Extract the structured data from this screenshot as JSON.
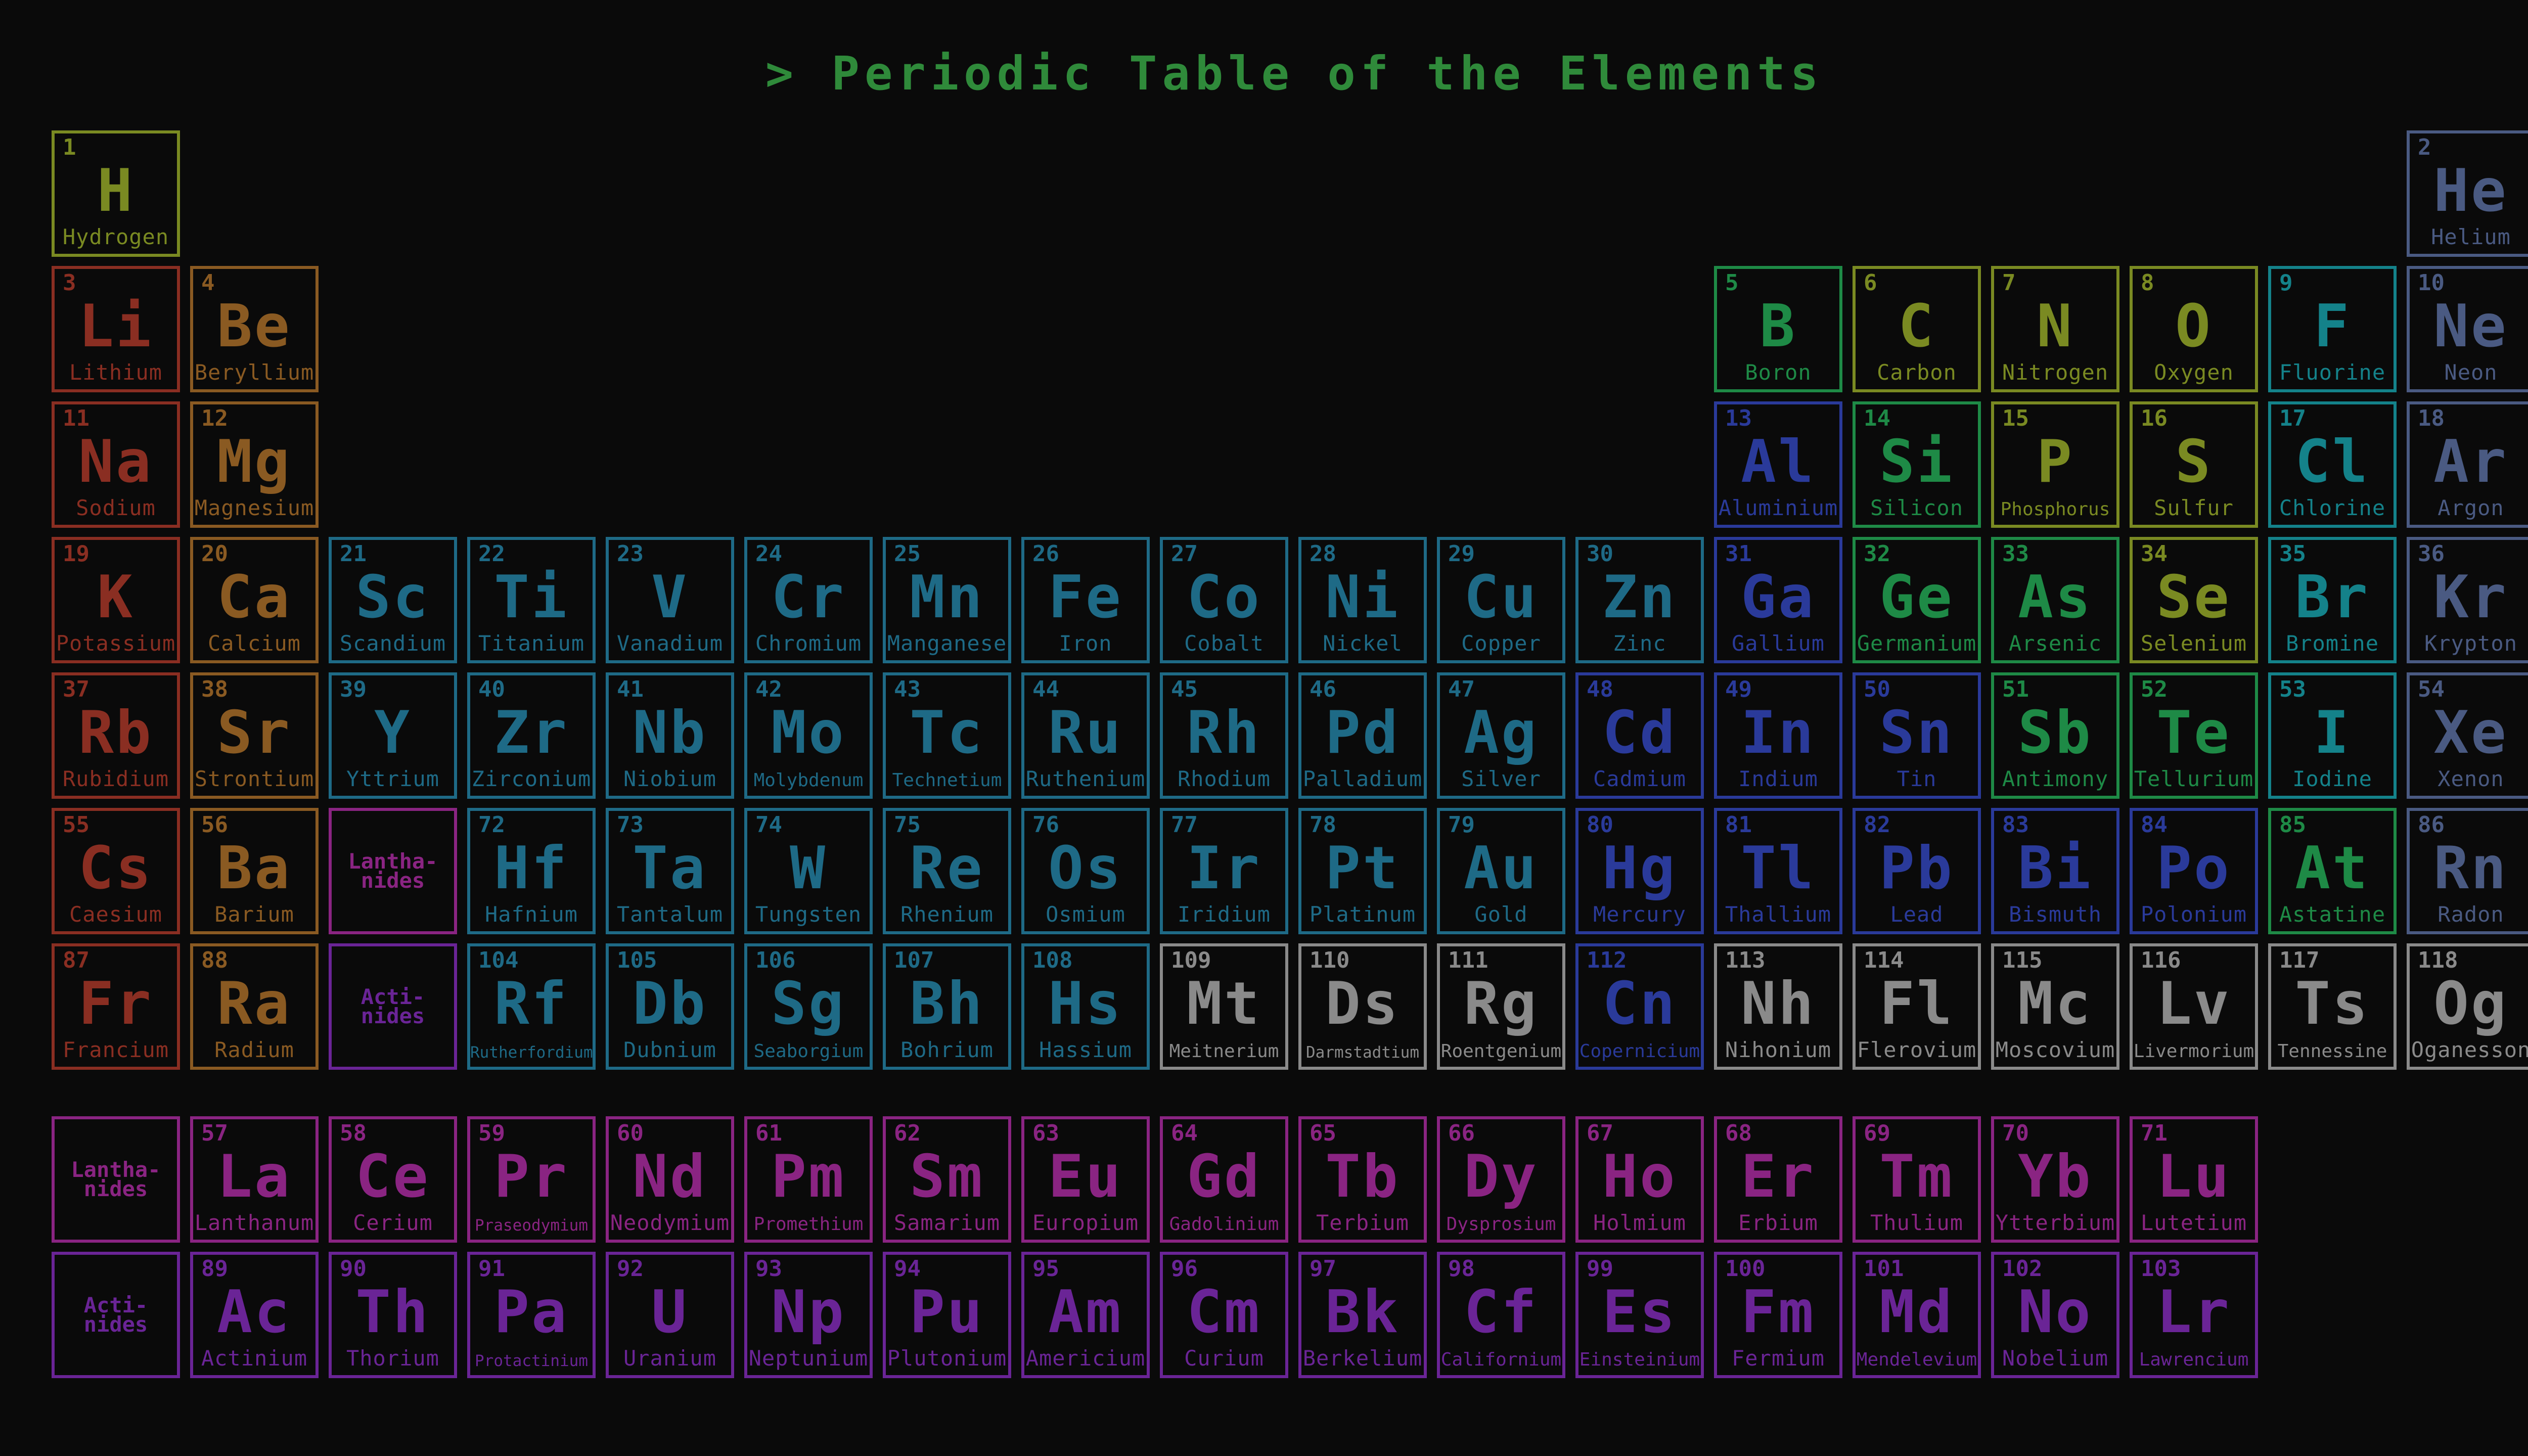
{
  "title": "> Periodic Table of the Elements",
  "colors": {
    "hydrogen": "#7a8a22",
    "alkali": "#8a2e22",
    "alkaline": "#8a5a22",
    "transition": "#1e6a86",
    "post_transition": "#2a3a9a",
    "metalloid": "#1e8a46",
    "nonmetal": "#7a8a22",
    "halogen": "#14828a",
    "noble": "#4a5a82",
    "lanthanide": "#8a2482",
    "actinide": "#6a2496",
    "unknown": "#8a8a8a"
  },
  "placeholders": {
    "lanthanides": "Lantha-\nnides",
    "actinides": "Acti-\nnides"
  },
  "elements": [
    {
      "n": 1,
      "s": "H",
      "name": "Hydrogen",
      "cat": "hydrogen",
      "row": 1,
      "col": 1
    },
    {
      "n": 2,
      "s": "He",
      "name": "Helium",
      "cat": "noble",
      "row": 1,
      "col": 18
    },
    {
      "n": 3,
      "s": "Li",
      "name": "Lithium",
      "cat": "alkali",
      "row": 2,
      "col": 1
    },
    {
      "n": 4,
      "s": "Be",
      "name": "Beryllium",
      "cat": "alkaline",
      "row": 2,
      "col": 2
    },
    {
      "n": 5,
      "s": "B",
      "name": "Boron",
      "cat": "metalloid",
      "row": 2,
      "col": 13
    },
    {
      "n": 6,
      "s": "C",
      "name": "Carbon",
      "cat": "nonmetal",
      "row": 2,
      "col": 14
    },
    {
      "n": 7,
      "s": "N",
      "name": "Nitrogen",
      "cat": "nonmetal",
      "row": 2,
      "col": 15
    },
    {
      "n": 8,
      "s": "O",
      "name": "Oxygen",
      "cat": "nonmetal",
      "row": 2,
      "col": 16
    },
    {
      "n": 9,
      "s": "F",
      "name": "Fluorine",
      "cat": "halogen",
      "row": 2,
      "col": 17
    },
    {
      "n": 10,
      "s": "Ne",
      "name": "Neon",
      "cat": "noble",
      "row": 2,
      "col": 18
    },
    {
      "n": 11,
      "s": "Na",
      "name": "Sodium",
      "cat": "alkali",
      "row": 3,
      "col": 1
    },
    {
      "n": 12,
      "s": "Mg",
      "name": "Magnesium",
      "cat": "alkaline",
      "row": 3,
      "col": 2
    },
    {
      "n": 13,
      "s": "Al",
      "name": "Aluminium",
      "cat": "post_transition",
      "row": 3,
      "col": 13
    },
    {
      "n": 14,
      "s": "Si",
      "name": "Silicon",
      "cat": "metalloid",
      "row": 3,
      "col": 14
    },
    {
      "n": 15,
      "s": "P",
      "name": "Phosphorus",
      "cat": "nonmetal",
      "row": 3,
      "col": 15
    },
    {
      "n": 16,
      "s": "S",
      "name": "Sulfur",
      "cat": "nonmetal",
      "row": 3,
      "col": 16
    },
    {
      "n": 17,
      "s": "Cl",
      "name": "Chlorine",
      "cat": "halogen",
      "row": 3,
      "col": 17
    },
    {
      "n": 18,
      "s": "Ar",
      "name": "Argon",
      "cat": "noble",
      "row": 3,
      "col": 18
    },
    {
      "n": 19,
      "s": "K",
      "name": "Potassium",
      "cat": "alkali",
      "row": 4,
      "col": 1
    },
    {
      "n": 20,
      "s": "Ca",
      "name": "Calcium",
      "cat": "alkaline",
      "row": 4,
      "col": 2
    },
    {
      "n": 21,
      "s": "Sc",
      "name": "Scandium",
      "cat": "transition",
      "row": 4,
      "col": 3
    },
    {
      "n": 22,
      "s": "Ti",
      "name": "Titanium",
      "cat": "transition",
      "row": 4,
      "col": 4
    },
    {
      "n": 23,
      "s": "V",
      "name": "Vanadium",
      "cat": "transition",
      "row": 4,
      "col": 5
    },
    {
      "n": 24,
      "s": "Cr",
      "name": "Chromium",
      "cat": "transition",
      "row": 4,
      "col": 6
    },
    {
      "n": 25,
      "s": "Mn",
      "name": "Manganese",
      "cat": "transition",
      "row": 4,
      "col": 7
    },
    {
      "n": 26,
      "s": "Fe",
      "name": "Iron",
      "cat": "transition",
      "row": 4,
      "col": 8
    },
    {
      "n": 27,
      "s": "Co",
      "name": "Cobalt",
      "cat": "transition",
      "row": 4,
      "col": 9
    },
    {
      "n": 28,
      "s": "Ni",
      "name": "Nickel",
      "cat": "transition",
      "row": 4,
      "col": 10
    },
    {
      "n": 29,
      "s": "Cu",
      "name": "Copper",
      "cat": "transition",
      "row": 4,
      "col": 11
    },
    {
      "n": 30,
      "s": "Zn",
      "name": "Zinc",
      "cat": "transition",
      "row": 4,
      "col": 12
    },
    {
      "n": 31,
      "s": "Ga",
      "name": "Gallium",
      "cat": "post_transition",
      "row": 4,
      "col": 13
    },
    {
      "n": 32,
      "s": "Ge",
      "name": "Germanium",
      "cat": "metalloid",
      "row": 4,
      "col": 14
    },
    {
      "n": 33,
      "s": "As",
      "name": "Arsenic",
      "cat": "metalloid",
      "row": 4,
      "col": 15
    },
    {
      "n": 34,
      "s": "Se",
      "name": "Selenium",
      "cat": "nonmetal",
      "row": 4,
      "col": 16
    },
    {
      "n": 35,
      "s": "Br",
      "name": "Bromine",
      "cat": "halogen",
      "row": 4,
      "col": 17
    },
    {
      "n": 36,
      "s": "Kr",
      "name": "Krypton",
      "cat": "noble",
      "row": 4,
      "col": 18
    },
    {
      "n": 37,
      "s": "Rb",
      "name": "Rubidium",
      "cat": "alkali",
      "row": 5,
      "col": 1
    },
    {
      "n": 38,
      "s": "Sr",
      "name": "Strontium",
      "cat": "alkaline",
      "row": 5,
      "col": 2
    },
    {
      "n": 39,
      "s": "Y",
      "name": "Yttrium",
      "cat": "transition",
      "row": 5,
      "col": 3
    },
    {
      "n": 40,
      "s": "Zr",
      "name": "Zirconium",
      "cat": "transition",
      "row": 5,
      "col": 4
    },
    {
      "n": 41,
      "s": "Nb",
      "name": "Niobium",
      "cat": "transition",
      "row": 5,
      "col": 5
    },
    {
      "n": 42,
      "s": "Mo",
      "name": "Molybdenum",
      "cat": "transition",
      "row": 5,
      "col": 6
    },
    {
      "n": 43,
      "s": "Tc",
      "name": "Technetium",
      "cat": "transition",
      "row": 5,
      "col": 7
    },
    {
      "n": 44,
      "s": "Ru",
      "name": "Ruthenium",
      "cat": "transition",
      "row": 5,
      "col": 8
    },
    {
      "n": 45,
      "s": "Rh",
      "name": "Rhodium",
      "cat": "transition",
      "row": 5,
      "col": 9
    },
    {
      "n": 46,
      "s": "Pd",
      "name": "Palladium",
      "cat": "transition",
      "row": 5,
      "col": 10
    },
    {
      "n": 47,
      "s": "Ag",
      "name": "Silver",
      "cat": "transition",
      "row": 5,
      "col": 11
    },
    {
      "n": 48,
      "s": "Cd",
      "name": "Cadmium",
      "cat": "post_transition",
      "row": 5,
      "col": 12
    },
    {
      "n": 49,
      "s": "In",
      "name": "Indium",
      "cat": "post_transition",
      "row": 5,
      "col": 13
    },
    {
      "n": 50,
      "s": "Sn",
      "name": "Tin",
      "cat": "post_transition",
      "row": 5,
      "col": 14
    },
    {
      "n": 51,
      "s": "Sb",
      "name": "Antimony",
      "cat": "metalloid",
      "row": 5,
      "col": 15
    },
    {
      "n": 52,
      "s": "Te",
      "name": "Tellurium",
      "cat": "metalloid",
      "row": 5,
      "col": 16
    },
    {
      "n": 53,
      "s": "I",
      "name": "Iodine",
      "cat": "halogen",
      "row": 5,
      "col": 17
    },
    {
      "n": 54,
      "s": "Xe",
      "name": "Xenon",
      "cat": "noble",
      "row": 5,
      "col": 18
    },
    {
      "n": 55,
      "s": "Cs",
      "name": "Caesium",
      "cat": "alkali",
      "row": 6,
      "col": 1
    },
    {
      "n": 56,
      "s": "Ba",
      "name": "Barium",
      "cat": "alkaline",
      "row": 6,
      "col": 2
    },
    {
      "n": 72,
      "s": "Hf",
      "name": "Hafnium",
      "cat": "transition",
      "row": 6,
      "col": 4
    },
    {
      "n": 73,
      "s": "Ta",
      "name": "Tantalum",
      "cat": "transition",
      "row": 6,
      "col": 5
    },
    {
      "n": 74,
      "s": "W",
      "name": "Tungsten",
      "cat": "transition",
      "row": 6,
      "col": 6
    },
    {
      "n": 75,
      "s": "Re",
      "name": "Rhenium",
      "cat": "transition",
      "row": 6,
      "col": 7
    },
    {
      "n": 76,
      "s": "Os",
      "name": "Osmium",
      "cat": "transition",
      "row": 6,
      "col": 8
    },
    {
      "n": 77,
      "s": "Ir",
      "name": "Iridium",
      "cat": "transition",
      "row": 6,
      "col": 9
    },
    {
      "n": 78,
      "s": "Pt",
      "name": "Platinum",
      "cat": "transition",
      "row": 6,
      "col": 10
    },
    {
      "n": 79,
      "s": "Au",
      "name": "Gold",
      "cat": "transition",
      "row": 6,
      "col": 11
    },
    {
      "n": 80,
      "s": "Hg",
      "name": "Mercury",
      "cat": "post_transition",
      "row": 6,
      "col": 12
    },
    {
      "n": 81,
      "s": "Tl",
      "name": "Thallium",
      "cat": "post_transition",
      "row": 6,
      "col": 13
    },
    {
      "n": 82,
      "s": "Pb",
      "name": "Lead",
      "cat": "post_transition",
      "row": 6,
      "col": 14
    },
    {
      "n": 83,
      "s": "Bi",
      "name": "Bismuth",
      "cat": "post_transition",
      "row": 6,
      "col": 15
    },
    {
      "n": 84,
      "s": "Po",
      "name": "Polonium",
      "cat": "post_transition",
      "row": 6,
      "col": 16
    },
    {
      "n": 85,
      "s": "At",
      "name": "Astatine",
      "cat": "metalloid",
      "row": 6,
      "col": 17
    },
    {
      "n": 86,
      "s": "Rn",
      "name": "Radon",
      "cat": "noble",
      "row": 6,
      "col": 18
    },
    {
      "n": 87,
      "s": "Fr",
      "name": "Francium",
      "cat": "alkali",
      "row": 7,
      "col": 1
    },
    {
      "n": 88,
      "s": "Ra",
      "name": "Radium",
      "cat": "alkaline",
      "row": 7,
      "col": 2
    },
    {
      "n": 104,
      "s": "Rf",
      "name": "Rutherfordium",
      "cat": "transition",
      "row": 7,
      "col": 4
    },
    {
      "n": 105,
      "s": "Db",
      "name": "Dubnium",
      "cat": "transition",
      "row": 7,
      "col": 5
    },
    {
      "n": 106,
      "s": "Sg",
      "name": "Seaborgium",
      "cat": "transition",
      "row": 7,
      "col": 6
    },
    {
      "n": 107,
      "s": "Bh",
      "name": "Bohrium",
      "cat": "transition",
      "row": 7,
      "col": 7
    },
    {
      "n": 108,
      "s": "Hs",
      "name": "Hassium",
      "cat": "transition",
      "row": 7,
      "col": 8
    },
    {
      "n": 109,
      "s": "Mt",
      "name": "Meitnerium",
      "cat": "unknown",
      "row": 7,
      "col": 9
    },
    {
      "n": 110,
      "s": "Ds",
      "name": "Darmstadtium",
      "cat": "unknown",
      "row": 7,
      "col": 10
    },
    {
      "n": 111,
      "s": "Rg",
      "name": "Roentgenium",
      "cat": "unknown",
      "row": 7,
      "col": 11
    },
    {
      "n": 112,
      "s": "Cn",
      "name": "Copernicium",
      "cat": "post_transition",
      "row": 7,
      "col": 12
    },
    {
      "n": 113,
      "s": "Nh",
      "name": "Nihonium",
      "cat": "unknown",
      "row": 7,
      "col": 13
    },
    {
      "n": 114,
      "s": "Fl",
      "name": "Flerovium",
      "cat": "unknown",
      "row": 7,
      "col": 14
    },
    {
      "n": 115,
      "s": "Mc",
      "name": "Moscovium",
      "cat": "unknown",
      "row": 7,
      "col": 15
    },
    {
      "n": 116,
      "s": "Lv",
      "name": "Livermorium",
      "cat": "unknown",
      "row": 7,
      "col": 16
    },
    {
      "n": 117,
      "s": "Ts",
      "name": "Tennessine",
      "cat": "unknown",
      "row": 7,
      "col": 17
    },
    {
      "n": 118,
      "s": "Og",
      "name": "Oganesson",
      "cat": "unknown",
      "row": 7,
      "col": 18
    },
    {
      "n": 57,
      "s": "La",
      "name": "Lanthanum",
      "cat": "lanthanide",
      "row": 9,
      "col": 2
    },
    {
      "n": 58,
      "s": "Ce",
      "name": "Cerium",
      "cat": "lanthanide",
      "row": 9,
      "col": 3
    },
    {
      "n": 59,
      "s": "Pr",
      "name": "Praseodymium",
      "cat": "lanthanide",
      "row": 9,
      "col": 4
    },
    {
      "n": 60,
      "s": "Nd",
      "name": "Neodymium",
      "cat": "lanthanide",
      "row": 9,
      "col": 5
    },
    {
      "n": 61,
      "s": "Pm",
      "name": "Promethium",
      "cat": "lanthanide",
      "row": 9,
      "col": 6
    },
    {
      "n": 62,
      "s": "Sm",
      "name": "Samarium",
      "cat": "lanthanide",
      "row": 9,
      "col": 7
    },
    {
      "n": 63,
      "s": "Eu",
      "name": "Europium",
      "cat": "lanthanide",
      "row": 9,
      "col": 8
    },
    {
      "n": 64,
      "s": "Gd",
      "name": "Gadolinium",
      "cat": "lanthanide",
      "row": 9,
      "col": 9
    },
    {
      "n": 65,
      "s": "Tb",
      "name": "Terbium",
      "cat": "lanthanide",
      "row": 9,
      "col": 10
    },
    {
      "n": 66,
      "s": "Dy",
      "name": "Dysprosium",
      "cat": "lanthanide",
      "row": 9,
      "col": 11
    },
    {
      "n": 67,
      "s": "Ho",
      "name": "Holmium",
      "cat": "lanthanide",
      "row": 9,
      "col": 12
    },
    {
      "n": 68,
      "s": "Er",
      "name": "Erbium",
      "cat": "lanthanide",
      "row": 9,
      "col": 13
    },
    {
      "n": 69,
      "s": "Tm",
      "name": "Thulium",
      "cat": "lanthanide",
      "row": 9,
      "col": 14
    },
    {
      "n": 70,
      "s": "Yb",
      "name": "Ytterbium",
      "cat": "lanthanide",
      "row": 9,
      "col": 15
    },
    {
      "n": 71,
      "s": "Lu",
      "name": "Lutetium",
      "cat": "lanthanide",
      "row": 9,
      "col": 16
    },
    {
      "n": 89,
      "s": "Ac",
      "name": "Actinium",
      "cat": "actinide",
      "row": 10,
      "col": 2
    },
    {
      "n": 90,
      "s": "Th",
      "name": "Thorium",
      "cat": "actinide",
      "row": 10,
      "col": 3
    },
    {
      "n": 91,
      "s": "Pa",
      "name": "Protactinium",
      "cat": "actinide",
      "row": 10,
      "col": 4
    },
    {
      "n": 92,
      "s": "U",
      "name": "Uranium",
      "cat": "actinide",
      "row": 10,
      "col": 5
    },
    {
      "n": 93,
      "s": "Np",
      "name": "Neptunium",
      "cat": "actinide",
      "row": 10,
      "col": 6
    },
    {
      "n": 94,
      "s": "Pu",
      "name": "Plutonium",
      "cat": "actinide",
      "row": 10,
      "col": 7
    },
    {
      "n": 95,
      "s": "Am",
      "name": "Americium",
      "cat": "actinide",
      "row": 10,
      "col": 8
    },
    {
      "n": 96,
      "s": "Cm",
      "name": "Curium",
      "cat": "actinide",
      "row": 10,
      "col": 9
    },
    {
      "n": 97,
      "s": "Bk",
      "name": "Berkelium",
      "cat": "actinide",
      "row": 10,
      "col": 10
    },
    {
      "n": 98,
      "s": "Cf",
      "name": "Californium",
      "cat": "actinide",
      "row": 10,
      "col": 11
    },
    {
      "n": 99,
      "s": "Es",
      "name": "Einsteinium",
      "cat": "actinide",
      "row": 10,
      "col": 12
    },
    {
      "n": 100,
      "s": "Fm",
      "name": "Fermium",
      "cat": "actinide",
      "row": 10,
      "col": 13
    },
    {
      "n": 101,
      "s": "Md",
      "name": "Mendelevium",
      "cat": "actinide",
      "row": 10,
      "col": 14
    },
    {
      "n": 102,
      "s": "No",
      "name": "Nobelium",
      "cat": "actinide",
      "row": 10,
      "col": 15
    },
    {
      "n": 103,
      "s": "Lr",
      "name": "Lawrencium",
      "cat": "actinide",
      "row": 10,
      "col": 16
    }
  ],
  "placeholder_cells": [
    {
      "key": "lanthanides",
      "cat": "lanthanide",
      "row": 6,
      "col": 3
    },
    {
      "key": "actinides",
      "cat": "actinide",
      "row": 7,
      "col": 3
    },
    {
      "key": "lanthanides",
      "cat": "lanthanide",
      "row": 9,
      "col": 1
    },
    {
      "key": "actinides",
      "cat": "actinide",
      "row": 10,
      "col": 1
    }
  ]
}
